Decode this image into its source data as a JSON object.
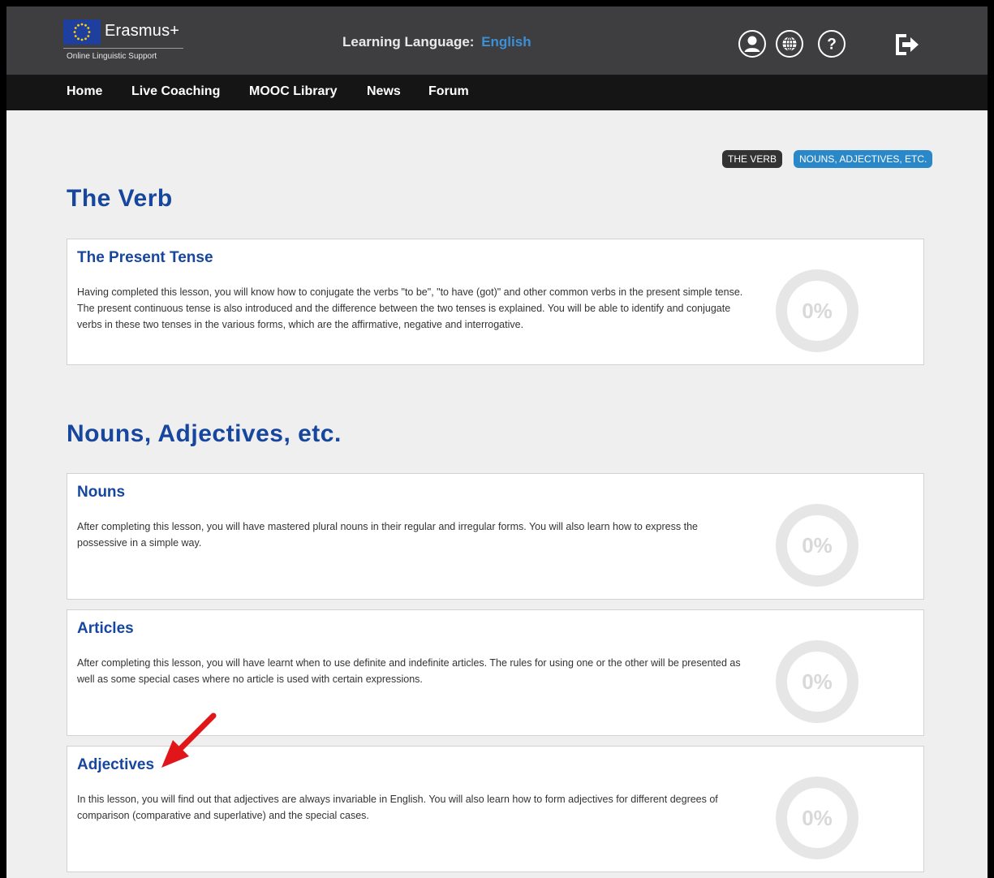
{
  "header": {
    "brand_name": "Erasmus+",
    "brand_subtitle": "Online Linguistic Support",
    "learning_language_label": "Learning Language:",
    "learning_language_value": "English",
    "icons": [
      "user-icon",
      "globe-icon",
      "help-icon",
      "logout-icon"
    ]
  },
  "nav": {
    "items": [
      "Home",
      "Live Coaching",
      "MOOC Library",
      "News",
      "Forum"
    ]
  },
  "chips": {
    "verb": "THE VERB",
    "nouns": "NOUNS, ADJECTIVES, ETC."
  },
  "sections": [
    {
      "title": "The Verb",
      "lessons": [
        {
          "title": "The Present Tense",
          "description": "Having completed this lesson, you will know how to conjugate the verbs \"to be\", \"to have (got)\" and other common verbs in the present simple tense. The present continuous tense is also introduced and the difference between the two tenses is explained. You will be able to identify and conjugate verbs in these two tenses in the various forms, which are the affirmative, negative and interrogative.",
          "progress": "0%"
        }
      ]
    },
    {
      "title": "Nouns, Adjectives, etc.",
      "lessons": [
        {
          "title": "Nouns",
          "description": "After completing this lesson, you will have mastered plural nouns in their regular and irregular forms. You will also learn how to express the possessive in a simple way.",
          "progress": "0%"
        },
        {
          "title": "Articles",
          "description": "After completing this lesson, you will have learnt when to use definite and indefinite articles. The rules for using one or the other will be presented as well as some special cases where no article is used with certain expressions.",
          "progress": "0%"
        },
        {
          "title": "Adjectives",
          "description": "In this lesson, you will find out that adjectives are always invariable in English. You will also learn how to form adjectives for different degrees of comparison (comparative and superlative) and the special cases.",
          "progress": "0%"
        }
      ]
    }
  ],
  "colors": {
    "header_bg": "#3e3e40",
    "nav_bg": "#151515",
    "heading_blue": "#17469e",
    "accent_blue": "#2a88c8",
    "annotation_arrow": "#e0161b"
  }
}
